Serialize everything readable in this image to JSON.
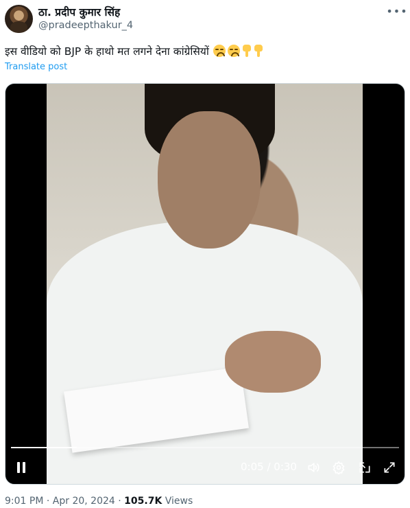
{
  "author": {
    "display_name": "ठा. प्रदीप कुमार सिंह",
    "handle": "@pradeepthakur_4"
  },
  "more_icon": "more-horizontal-icon",
  "post": {
    "text": "इस वीडियो को BJP के हाथो मत लगने देना कांग्रेसियों",
    "emojis": [
      "disappointed-face",
      "disappointed-face",
      "backhand-index-pointing-down",
      "backhand-index-pointing-down"
    ],
    "translate_label": "Translate post"
  },
  "video": {
    "current_time": "0:05",
    "duration": "0:30",
    "time_display": "0:05 / 0:30",
    "progress_fraction": 0.17,
    "controls": [
      "pause-icon",
      "volume-icon",
      "settings-icon",
      "picture-in-picture-icon",
      "fullscreen-icon"
    ]
  },
  "meta": {
    "time": "9:01 PM",
    "date": "Apr 20, 2024",
    "views_count": "105.7K",
    "views_label": "Views"
  },
  "colors": {
    "text_primary": "#0f1419",
    "text_secondary": "#536471",
    "link": "#1d9bf0"
  }
}
